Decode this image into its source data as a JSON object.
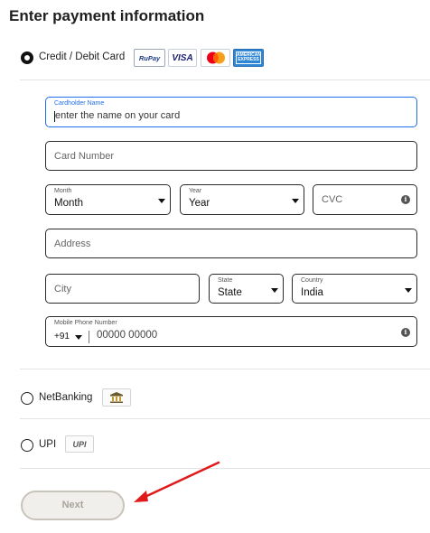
{
  "title": "Enter payment information",
  "methods": {
    "card": {
      "label": "Credit / Debit Card",
      "selected": true,
      "logos": [
        "RuPay",
        "VISA",
        "mastercard",
        "AMERICAN EXPRESS"
      ]
    },
    "netbanking": {
      "label": "NetBanking",
      "selected": false
    },
    "upi": {
      "label": "UPI",
      "selected": false,
      "logo": "UPI"
    }
  },
  "form": {
    "cardholder": {
      "label": "Cardholder Name",
      "placeholder": "enter the name on your card"
    },
    "card_number": {
      "placeholder": "Card Number"
    },
    "month": {
      "label": "Month",
      "value": "Month"
    },
    "year": {
      "label": "Year",
      "value": "Year"
    },
    "cvc": {
      "placeholder": "CVC"
    },
    "address": {
      "placeholder": "Address"
    },
    "city": {
      "placeholder": "City"
    },
    "state": {
      "label": "State",
      "value": "State"
    },
    "country": {
      "label": "Country",
      "value": "India"
    },
    "phone": {
      "label": "Mobile Phone Number",
      "code": "+91",
      "placeholder": "00000 00000"
    }
  },
  "next_label": "Next",
  "colors": {
    "accent": "#1f6feb",
    "arrow": "#e0191b",
    "button_bg": "#f1efec",
    "button_text": "#a8a39b"
  }
}
